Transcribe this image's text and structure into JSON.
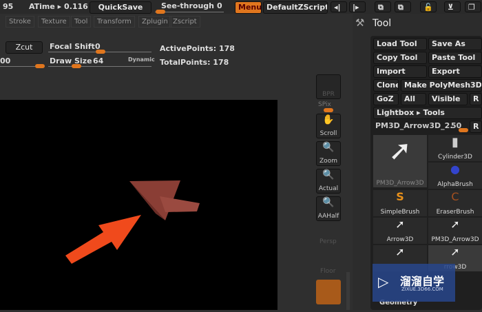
{
  "topbar": {
    "fps": "95",
    "atime": "ATime ▸ 0.116",
    "quicksave": "QuickSave",
    "seethrough": "See-through",
    "seethrough_value": "0",
    "menus": "Menus",
    "script": "DefaultZScript"
  },
  "menus": [
    "Stroke",
    "Texture",
    "Tool",
    "Transform",
    "Zplugin",
    "Zscript"
  ],
  "controls": {
    "zcut": "Zcut",
    "focal_shift": "Focal Shift",
    "focal_value": "0",
    "left_value": "00",
    "draw_size": "Draw Size",
    "draw_value": "64",
    "dynamic": "Dynamic",
    "active_points": "ActivePoints: 178",
    "total_points": "TotalPoints: 178"
  },
  "side": {
    "bpr": "BPR",
    "spix": "SPix",
    "scroll": "Scroll",
    "zoom": "Zoom",
    "actual": "Actual",
    "aahalf": "AAHalf",
    "persp": "Persp",
    "floor": "Floor"
  },
  "tool": {
    "title": "Tool",
    "load": "Load Tool",
    "save": "Save As",
    "copy": "Copy Tool",
    "paste": "Paste Tool",
    "import": "Import",
    "export": "Export",
    "clone": "Clone",
    "make": "Make PolyMesh3D",
    "goz": "GoZ",
    "all": "All",
    "visible": "Visible",
    "r": "R",
    "lightbox": "Lightbox ▸ Tools",
    "current": "PM3D_Arrow3D_2.",
    "current_value": "50",
    "items": [
      "PM3D_Arrow3D",
      "Cylinder3D",
      "AlphaBrush",
      "SimpleBrush",
      "EraserBrush",
      "Arrow3D",
      "PM3D_Arrow3D",
      "",
      "rrow3D"
    ],
    "geometry": "Geometry"
  },
  "watermark": {
    "cn": "溜溜自学",
    "url": "ZIXUE.3D66.COM"
  },
  "colors": {
    "accent": "#e0761e",
    "annotation": "#f04a1c"
  }
}
